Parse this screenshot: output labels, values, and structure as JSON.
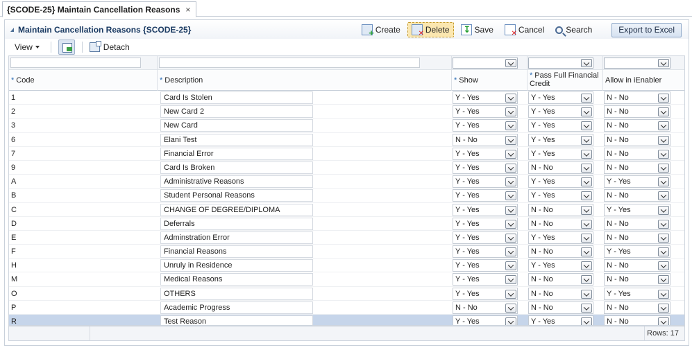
{
  "tab": {
    "title": "{SCODE-25} Maintain Cancellation Reasons",
    "close": "×"
  },
  "panel": {
    "title": "Maintain Cancellation Reasons {SCODE-25}"
  },
  "actions": {
    "create": "Create",
    "delete": "Delete",
    "save": "Save",
    "cancel": "Cancel",
    "search": "Search",
    "export": "Export to Excel"
  },
  "toolbar": {
    "view": "View",
    "detach": "Detach"
  },
  "columns": {
    "code": "Code",
    "description": "Description",
    "show": "Show",
    "pass_full": "Pass Full Financial Credit",
    "allow": "Allow in iEnabler",
    "required_mark": "*"
  },
  "rows": [
    {
      "code": "1",
      "description": "Card Is Stolen",
      "show": "Y - Yes",
      "pass": "Y - Yes",
      "allow": "N - No"
    },
    {
      "code": "2",
      "description": "New Card 2",
      "show": "Y - Yes",
      "pass": "Y - Yes",
      "allow": "N - No"
    },
    {
      "code": "3",
      "description": "New Card",
      "show": "Y - Yes",
      "pass": "Y - Yes",
      "allow": "N - No"
    },
    {
      "code": "6",
      "description": "Elani Test",
      "show": "N - No",
      "pass": "Y - Yes",
      "allow": "N - No"
    },
    {
      "code": "7",
      "description": "Financial Error",
      "show": "Y - Yes",
      "pass": "Y - Yes",
      "allow": "N - No"
    },
    {
      "code": "9",
      "description": "Card Is Broken",
      "show": "Y - Yes",
      "pass": "N - No",
      "allow": "N - No"
    },
    {
      "code": "A",
      "description": "Administrative Reasons",
      "show": "Y - Yes",
      "pass": "Y - Yes",
      "allow": "Y - Yes"
    },
    {
      "code": "B",
      "description": "Student Personal Reasons",
      "show": "Y - Yes",
      "pass": "Y - Yes",
      "allow": "N - No"
    },
    {
      "code": "C",
      "description": "CHANGE OF DEGREE/DIPLOMA",
      "show": "Y - Yes",
      "pass": "N - No",
      "allow": "Y - Yes"
    },
    {
      "code": "D",
      "description": "Deferrals",
      "show": "Y - Yes",
      "pass": "N - No",
      "allow": "N - No"
    },
    {
      "code": "E",
      "description": "Adminstration Error",
      "show": "Y - Yes",
      "pass": "Y - Yes",
      "allow": "N - No"
    },
    {
      "code": "F",
      "description": "Financial Reasons",
      "show": "Y - Yes",
      "pass": "N - No",
      "allow": "Y - Yes"
    },
    {
      "code": "H",
      "description": "Unruly in Residence",
      "show": "Y - Yes",
      "pass": "Y - Yes",
      "allow": "N - No"
    },
    {
      "code": "M",
      "description": "Medical Reasons",
      "show": "Y - Yes",
      "pass": "N - No",
      "allow": "N - No"
    },
    {
      "code": "O",
      "description": "OTHERS",
      "show": "Y - Yes",
      "pass": "N - No",
      "allow": "Y - Yes"
    },
    {
      "code": "P",
      "description": "Academic Progress",
      "show": "N - No",
      "pass": "N - No",
      "allow": "N - No"
    },
    {
      "code": "R",
      "description": "Test Reason",
      "show": "Y - Yes",
      "pass": "Y - Yes",
      "allow": "N - No"
    }
  ],
  "footer": {
    "rows_label": "Rows: 17"
  },
  "colors": {
    "accent": "#1a3a62",
    "selected_row": "#c6d5ea",
    "delete_highlight": "#fbe7b0"
  }
}
